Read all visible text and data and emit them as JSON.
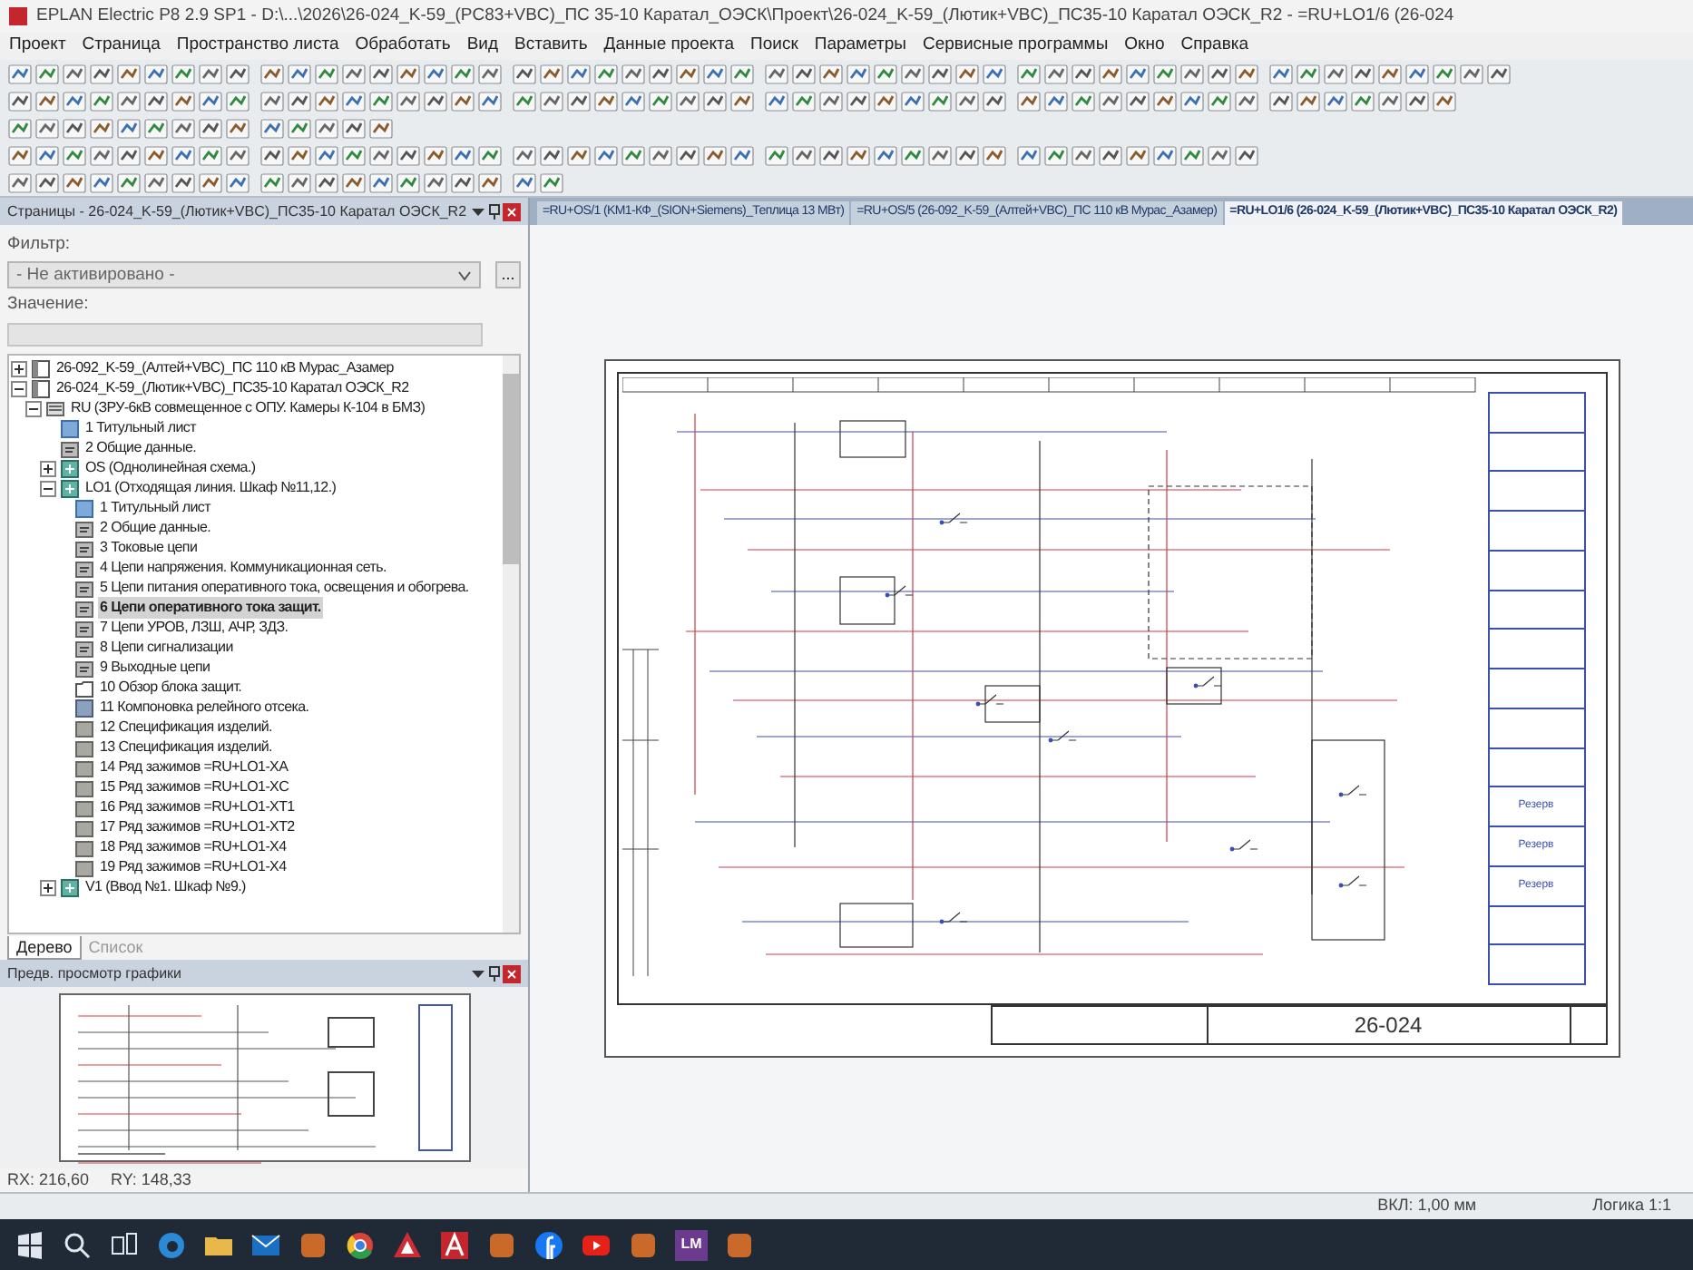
{
  "window": {
    "title": "EPLAN Electric P8 2.9 SP1 - D:\\...\\2026\\26-024_K-59_(PC83+VBC)_ПС 35-10 Каратал_ОЭСК\\Проект\\26-024_K-59_(Лютик+VBC)_ПС35-10 Каратал ОЭСК_R2 - =RU+LO1/6 (26-024"
  },
  "menu": [
    "Проект",
    "Страница",
    "Пространство листа",
    "Обработать",
    "Вид",
    "Вставить",
    "Данные проекта",
    "Поиск",
    "Параметры",
    "Сервисные программы",
    "Окно",
    "Справка"
  ],
  "pages_panel": {
    "title": "Страницы - 26-024_K-59_(Лютик+VBC)_ПС35-10 Каратал ОЭСК_R2",
    "filter_label": "Фильтр:",
    "filter_value": "- Не активировано -",
    "filter_button": "...",
    "value_label": "Значение:",
    "tree": [
      {
        "label": "26-092_K-59_(Алтей+VBC)_ПС 110 кВ Мурас_Азамер",
        "kind": "project",
        "expanded": false,
        "selected": false
      },
      {
        "label": "26-024_K-59_(Лютик+VBC)_ПС35-10 Каратал ОЭСК_R2",
        "kind": "project",
        "expanded": true,
        "selected": false,
        "children": [
          {
            "label": "RU (ЗРУ-6кВ совмещенное с ОПУ. Камеры К-104 в БМЗ)",
            "kind": "structure",
            "expanded": true,
            "selected": false,
            "children": [
              {
                "label": "1 Титульный лист",
                "kind": "title",
                "selected": false
              },
              {
                "label": "2 Общие данные.",
                "kind": "page",
                "selected": false
              },
              {
                "label": "OS (Однолинейная схема.)",
                "kind": "location",
                "expanded": false,
                "selected": false
              },
              {
                "label": "LO1 (Отходящая линия. Шкаф №11,12.)",
                "kind": "location",
                "expanded": true,
                "selected": false,
                "children": [
                  {
                    "label": "1 Титульный лист",
                    "kind": "title",
                    "selected": false
                  },
                  {
                    "label": "2 Общие данные.",
                    "kind": "page",
                    "selected": false
                  },
                  {
                    "label": "3 Токовые цепи",
                    "kind": "page",
                    "selected": false
                  },
                  {
                    "label": "4 Цепи напряжения. Коммуникационная сеть.",
                    "kind": "page",
                    "selected": false
                  },
                  {
                    "label": "5 Цепи питания оперативного тока, освещения и обогрева.",
                    "kind": "page",
                    "selected": false
                  },
                  {
                    "label": "6 Цепи оперативного тока защит.",
                    "kind": "page",
                    "selected": true
                  },
                  {
                    "label": "7 Цепи УРОВ, ЛЗШ, АЧР, ЗДЗ.",
                    "kind": "page",
                    "selected": false
                  },
                  {
                    "label": "8 Цепи сигнализации",
                    "kind": "page",
                    "selected": false
                  },
                  {
                    "label": "9 Выходные цепи",
                    "kind": "page",
                    "selected": false
                  },
                  {
                    "label": "10 Обзор блока защит.",
                    "kind": "overview",
                    "selected": false
                  },
                  {
                    "label": "11 Компоновка релейного отсека.",
                    "kind": "layout",
                    "selected": false
                  },
                  {
                    "label": "12 Спецификация изделий.",
                    "kind": "list",
                    "selected": false
                  },
                  {
                    "label": "13 Спецификация изделий.",
                    "kind": "list",
                    "selected": false
                  },
                  {
                    "label": "14 Ряд зажимов =RU+LO1-XA",
                    "kind": "list",
                    "selected": false
                  },
                  {
                    "label": "15 Ряд зажимов =RU+LO1-XC",
                    "kind": "list",
                    "selected": false
                  },
                  {
                    "label": "16 Ряд зажимов =RU+LO1-XT1",
                    "kind": "list",
                    "selected": false
                  },
                  {
                    "label": "17 Ряд зажимов =RU+LO1-XT2",
                    "kind": "list",
                    "selected": false
                  },
                  {
                    "label": "18 Ряд зажимов =RU+LO1-X4",
                    "kind": "list",
                    "selected": false
                  },
                  {
                    "label": "19 Ряд зажимов =RU+LO1-X4",
                    "kind": "list",
                    "selected": false
                  }
                ]
              },
              {
                "label": "V1 (Ввод №1. Шкаф №9.)",
                "kind": "location",
                "expanded": false,
                "selected": false
              }
            ]
          }
        ]
      }
    ],
    "tabs": [
      {
        "label": "Дерево",
        "selected": true
      },
      {
        "label": "Список",
        "selected": false
      }
    ]
  },
  "preview_panel": {
    "title": "Предв. просмотр графики"
  },
  "coordinates": [
    "RX: 216,60",
    "RY: 148,33"
  ],
  "document_tabs": [
    {
      "label": "=RU+OS/1 (KM1-КФ_(SION+Siemens)_Теплица 13 МВт)",
      "selected": false
    },
    {
      "label": "=RU+OS/5 (26-092_K-59_(Алтей+VBC)_ПС 110 кВ Мурас_Азамер)",
      "selected": false
    },
    {
      "label": "=RU+LO1/6 (26-024_K-59_(Лютик+VBC)_ПС35-10 Каратал ОЭСК_R2)",
      "selected": true
    }
  ],
  "drawing": {
    "legend": [
      "Резерв",
      "Резерв",
      "Резерв"
    ],
    "number": "26-024"
  },
  "status_bar": [
    "ВКЛ: 1,00 мм",
    "Логика 1:1"
  ],
  "taskbar": [
    {
      "kind": "start"
    },
    {
      "kind": "search"
    },
    {
      "kind": "taskview"
    },
    {
      "kind": "browser"
    },
    {
      "kind": "folder"
    },
    {
      "kind": "mail"
    },
    {
      "kind": "app"
    },
    {
      "kind": "chrome"
    },
    {
      "kind": "eplan"
    },
    {
      "kind": "autocad"
    },
    {
      "kind": "app"
    },
    {
      "kind": "facebook"
    },
    {
      "kind": "video"
    },
    {
      "kind": "app"
    },
    {
      "kind": "text",
      "label": "LM"
    },
    {
      "kind": "app"
    }
  ]
}
